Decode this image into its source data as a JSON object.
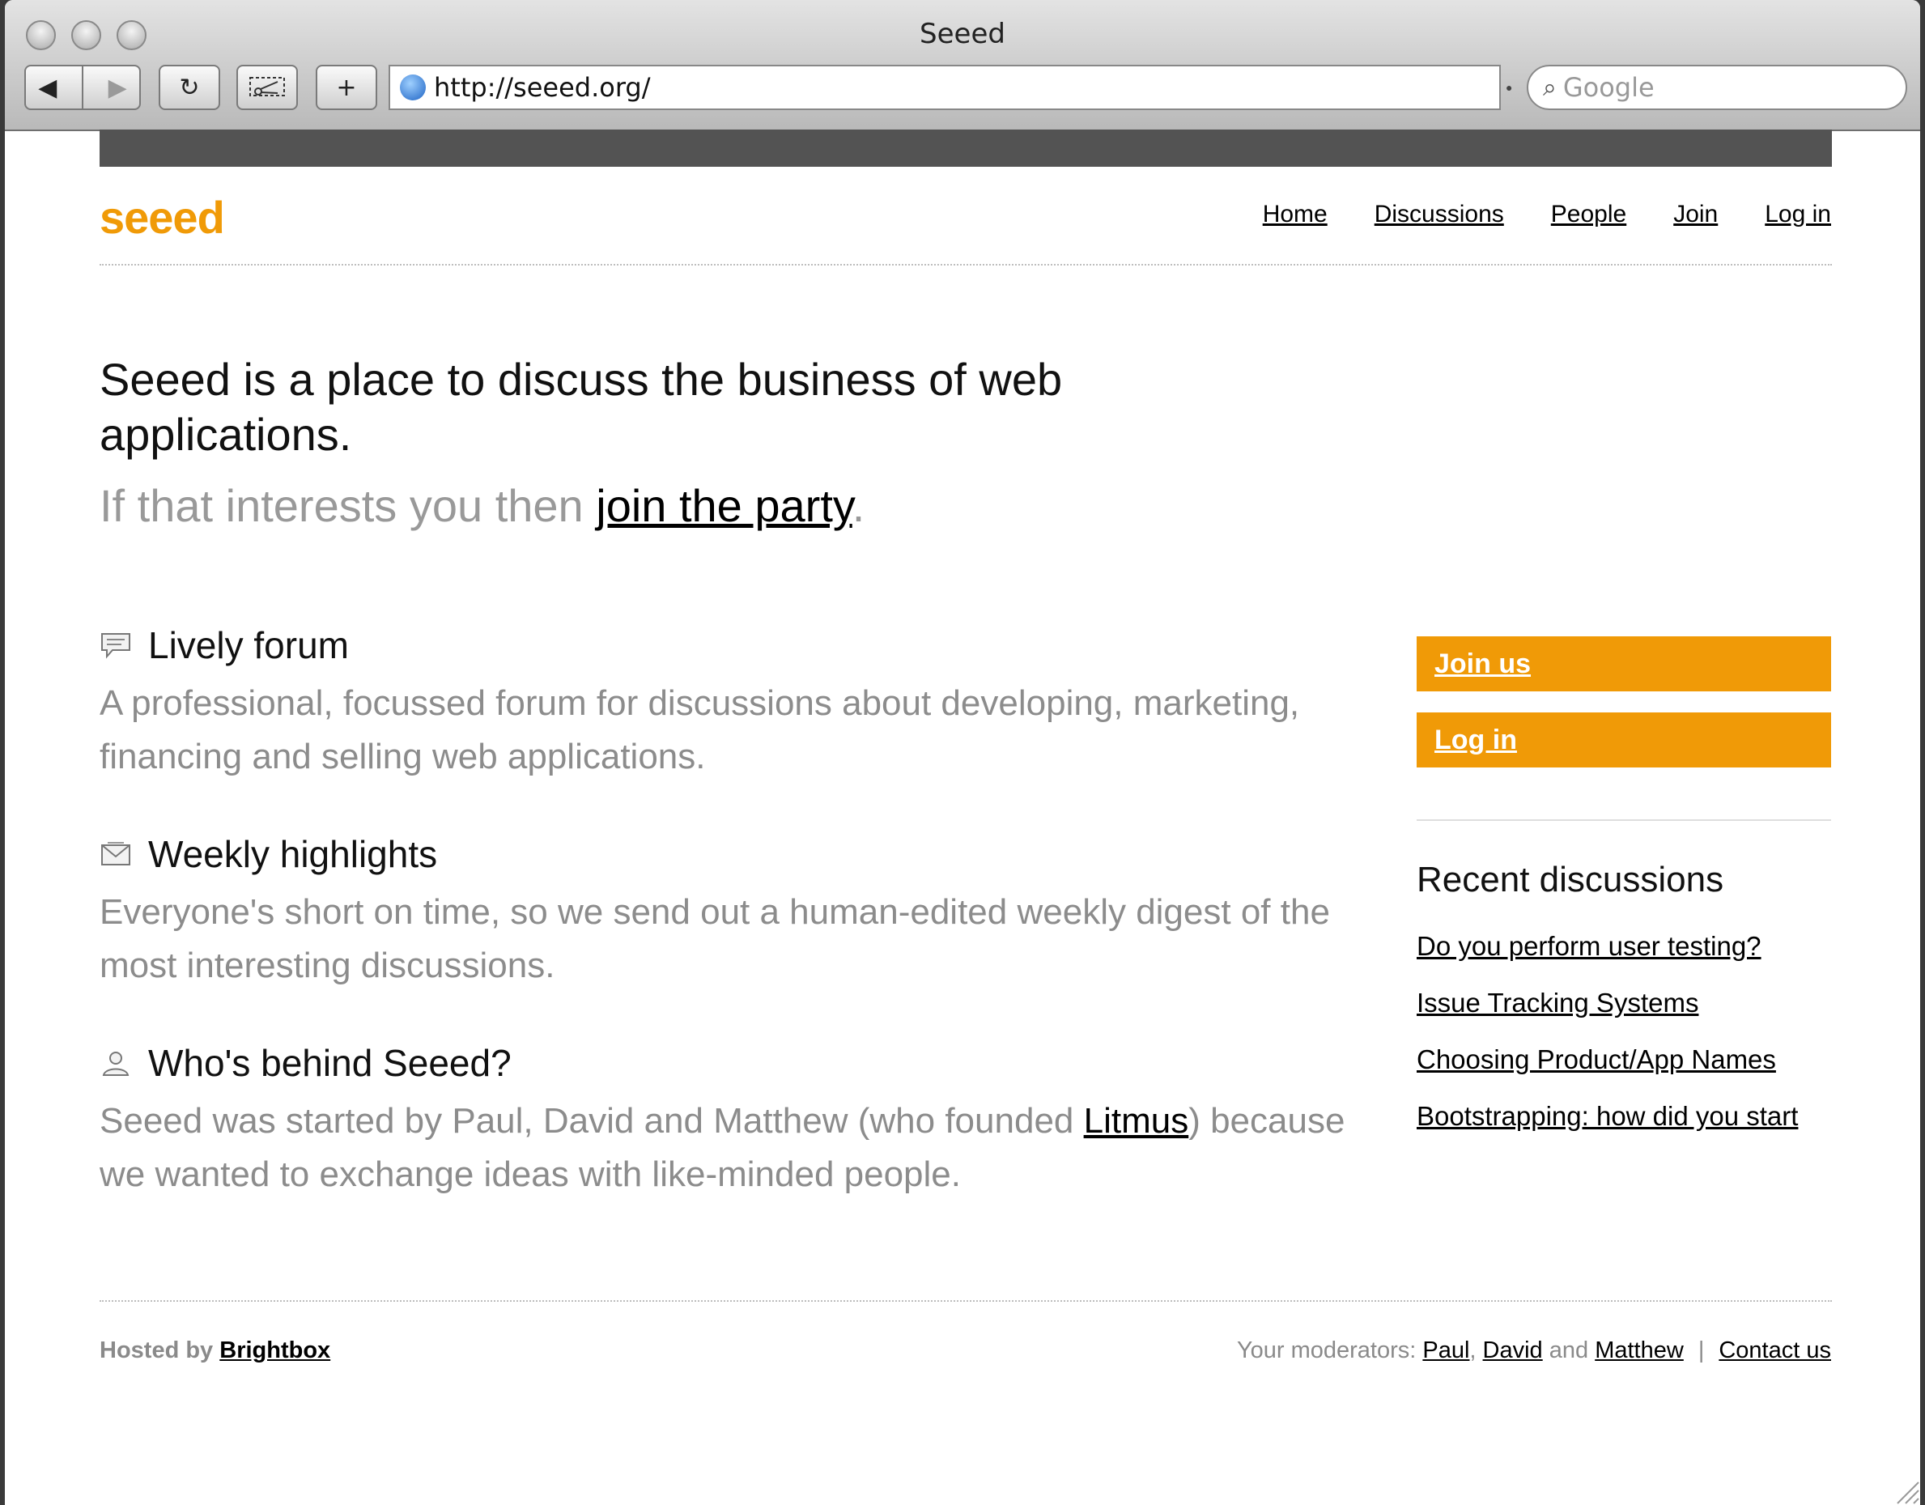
{
  "browser": {
    "window_title": "Seeed",
    "url": "http://seeed.org/",
    "search_placeholder": "Google",
    "back_glyph": "◀",
    "forward_glyph": "▶",
    "reload_glyph": "↻",
    "add_glyph": "+"
  },
  "site": {
    "logo": "seeed",
    "accent_color": "#f09a07",
    "nav": [
      "Home",
      "Discussions",
      "People",
      "Join",
      "Log in"
    ]
  },
  "hero": {
    "headline": "Seeed is a place to discuss the business of web applications.",
    "sub_prefix": "If that interests you then ",
    "sub_link": "join the party",
    "sub_suffix": "."
  },
  "features": [
    {
      "icon": "speech-bubble-icon",
      "title": "Lively forum",
      "text": "A professional, focussed forum for discussions about developing, marketing, financing and selling web applications."
    },
    {
      "icon": "envelope-icon",
      "title": "Weekly highlights",
      "text": "Everyone's short on time, so we send out a human-edited weekly digest of the most interesting discussions."
    },
    {
      "icon": "person-icon",
      "title": "Who's behind Seeed?",
      "text_prefix": "Seeed was started by Paul, David and Matthew (who founded ",
      "text_link": "Litmus",
      "text_suffix": ") because we wanted to exchange ideas with like-minded people."
    }
  ],
  "sidebar": {
    "join_label": "Join us",
    "login_label": "Log in",
    "recent_title": "Recent discussions",
    "recent": [
      "Do you perform user testing?",
      "Issue Tracking Systems",
      "Choosing Product/App Names",
      "Bootstrapping: how did you start"
    ]
  },
  "footer": {
    "hosted_prefix": "Hosted by ",
    "hosted_link": "Brightbox",
    "moderators_prefix": "Your moderators: ",
    "moderators": [
      "Paul",
      "David",
      "Matthew"
    ],
    "comma": ", ",
    "and": " and ",
    "separator": "|",
    "contact": "Contact us"
  }
}
